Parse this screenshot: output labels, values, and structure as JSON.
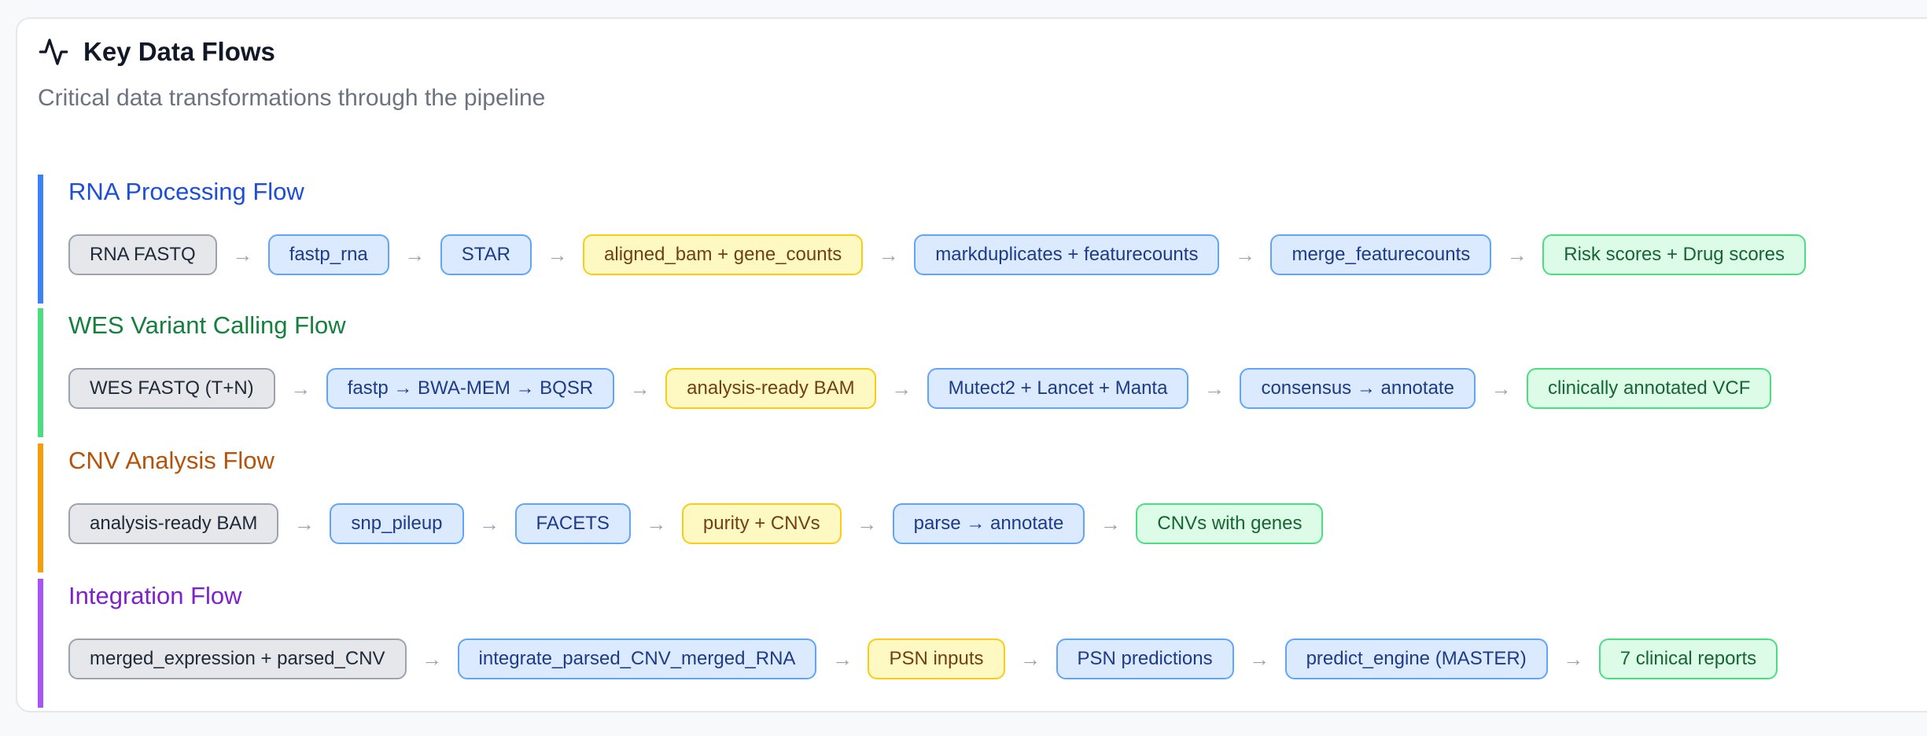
{
  "header": {
    "icon": "activity-icon",
    "title": "Key Data Flows",
    "subtitle": "Critical data transformations through the pipeline"
  },
  "flows": [
    {
      "title": "RNA Processing Flow",
      "accent": "#3b82f6",
      "title_color": "#1d4ed8",
      "steps": [
        {
          "label": "RNA FASTQ",
          "kind": "input"
        },
        {
          "label": "fastp_rna",
          "kind": "process"
        },
        {
          "label": "STAR",
          "kind": "process"
        },
        {
          "label": "aligned_bam + gene_counts",
          "kind": "data"
        },
        {
          "label": "markduplicates + featurecounts",
          "kind": "process"
        },
        {
          "label": "merge_featurecounts",
          "kind": "process"
        },
        {
          "label": "Risk scores + Drug scores",
          "kind": "output"
        }
      ]
    },
    {
      "title": "WES Variant Calling Flow",
      "accent": "#4ade80",
      "title_color": "#15803d",
      "steps": [
        {
          "label": "WES FASTQ (T+N)",
          "kind": "input"
        },
        {
          "label": "fastp → BWA-MEM → BQSR",
          "kind": "process"
        },
        {
          "label": "analysis-ready BAM",
          "kind": "data"
        },
        {
          "label": "Mutect2 + Lancet + Manta",
          "kind": "process"
        },
        {
          "label": "consensus → annotate",
          "kind": "process"
        },
        {
          "label": "clinically annotated VCF",
          "kind": "output"
        }
      ]
    },
    {
      "title": "CNV Analysis Flow",
      "accent": "#f59e0b",
      "title_color": "#b45309",
      "steps": [
        {
          "label": "analysis-ready BAM",
          "kind": "input"
        },
        {
          "label": "snp_pileup",
          "kind": "process"
        },
        {
          "label": "FACETS",
          "kind": "process"
        },
        {
          "label": "purity + CNVs",
          "kind": "data"
        },
        {
          "label": "parse → annotate",
          "kind": "process"
        },
        {
          "label": "CNVs with genes",
          "kind": "output"
        }
      ]
    },
    {
      "title": "Integration Flow",
      "accent": "#a855f7",
      "title_color": "#7e22ce",
      "steps": [
        {
          "label": "merged_expression + parsed_CNV",
          "kind": "input"
        },
        {
          "label": "integrate_parsed_CNV_merged_RNA",
          "kind": "process"
        },
        {
          "label": "PSN inputs",
          "kind": "data"
        },
        {
          "label": "PSN predictions",
          "kind": "process"
        },
        {
          "label": "predict_engine (MASTER)",
          "kind": "process"
        },
        {
          "label": "7 clinical reports",
          "kind": "output"
        }
      ]
    }
  ],
  "arrow_glyph": "→"
}
